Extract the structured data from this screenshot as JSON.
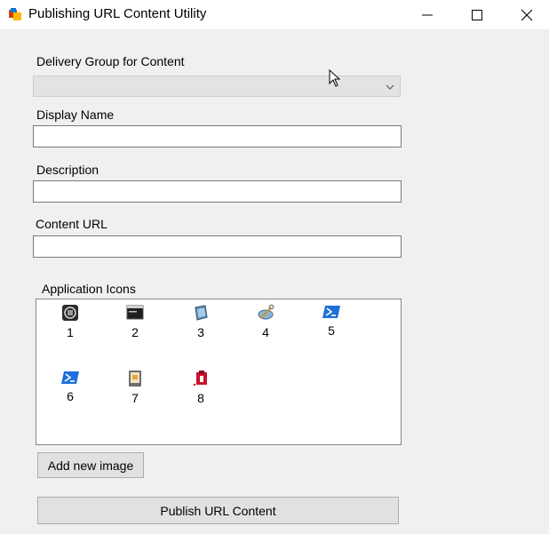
{
  "window": {
    "title": "Publishing URL Content Utility",
    "app_icon": "app-window-icon",
    "controls": {
      "minimize": "minimize-icon",
      "maximize": "maximize-icon",
      "close": "close-icon"
    }
  },
  "form": {
    "delivery_group": {
      "label": "Delivery Group for Content",
      "value": ""
    },
    "display_name": {
      "label": "Display Name",
      "value": ""
    },
    "description": {
      "label": "Description",
      "value": ""
    },
    "content_url": {
      "label": "Content URL",
      "value": ""
    }
  },
  "application_icons": {
    "label": "Application Icons",
    "items": [
      {
        "caption": "1",
        "icon": "circle-app-icon"
      },
      {
        "caption": "2",
        "icon": "terminal-window-icon"
      },
      {
        "caption": "3",
        "icon": "tablet-device-icon"
      },
      {
        "caption": "4",
        "icon": "wrench-tools-icon"
      },
      {
        "caption": "5",
        "icon": "powershell-icon"
      },
      {
        "caption": "6",
        "icon": "powershell-icon"
      },
      {
        "caption": "7",
        "icon": "document-app-icon"
      },
      {
        "caption": "8",
        "icon": "red-package-icon"
      }
    ]
  },
  "buttons": {
    "add_new_image": "Add new image",
    "publish": "Publish URL Content"
  },
  "colors": {
    "window_bg": "#f0f0f0",
    "titlebar_bg": "#ffffff",
    "button_bg": "#e1e1e1",
    "disabled_combo_bg": "#e3e3e3",
    "powershell_blue": "#1e6fd9",
    "package_red": "#c8102e"
  }
}
